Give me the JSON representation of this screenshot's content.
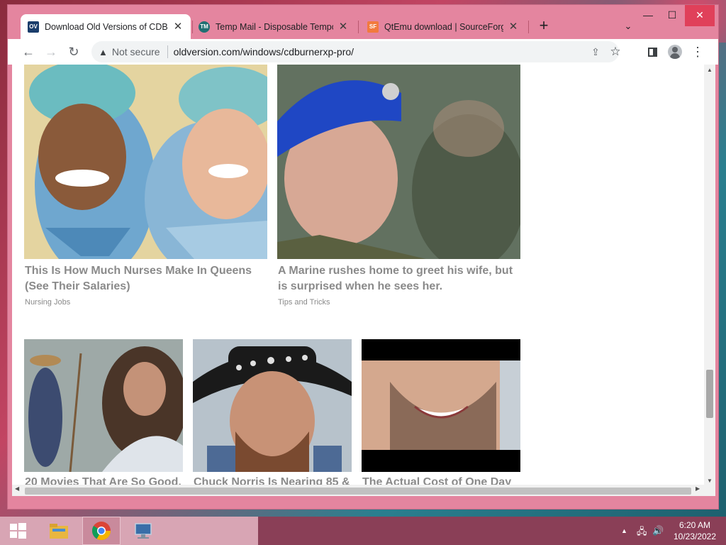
{
  "browser": {
    "tabs": [
      {
        "favicon": "OV",
        "favicon_color": "#1a3d6b",
        "title": "Download Old Versions of CDBurnerXP",
        "active": true
      },
      {
        "favicon": "TM",
        "favicon_color": "#1f6f72",
        "title": "Temp Mail - Disposable Temporary Email",
        "active": false
      },
      {
        "favicon": "SF",
        "favicon_color": "#f27a3d",
        "title": "QtEmu download | SourceForge.net",
        "active": false
      }
    ],
    "new_tab_label": "+",
    "tab_search_icon": "chevron-down-icon",
    "window_controls": {
      "minimize": "—",
      "maximize": "☐",
      "close": "✕"
    },
    "toolbar": {
      "back": "←",
      "forward": "→",
      "reload": "↻",
      "security_label": "Not secure",
      "url": "oldversion.com/windows/cdburnerxp-pro/"
    }
  },
  "content": {
    "row1": [
      {
        "headline_line1": "This Is How Much Nurses Make In Queens",
        "headline_line2": "(See Their Salaries)",
        "source": "Nursing Jobs",
        "image": "two-nurses-smiling"
      },
      {
        "headline_line1": "A Marine rushes home to greet his wife, but",
        "headline_line2": "is surprised when he sees her.",
        "source": "Tips and Tricks",
        "image": "soldier-blue-beret"
      }
    ],
    "row2": [
      {
        "headline": "20 Movies That Are So Good,",
        "image": "bearded-man-praying"
      },
      {
        "headline": "Chuck Norris Is Nearing 85 &",
        "image": "man-cowboy-hat"
      },
      {
        "headline": "The Actual Cost of One Day",
        "image": "smiling-teeth-closeup"
      }
    ]
  },
  "taskbar": {
    "time": "6:20 AM",
    "date": "10/23/2022"
  }
}
